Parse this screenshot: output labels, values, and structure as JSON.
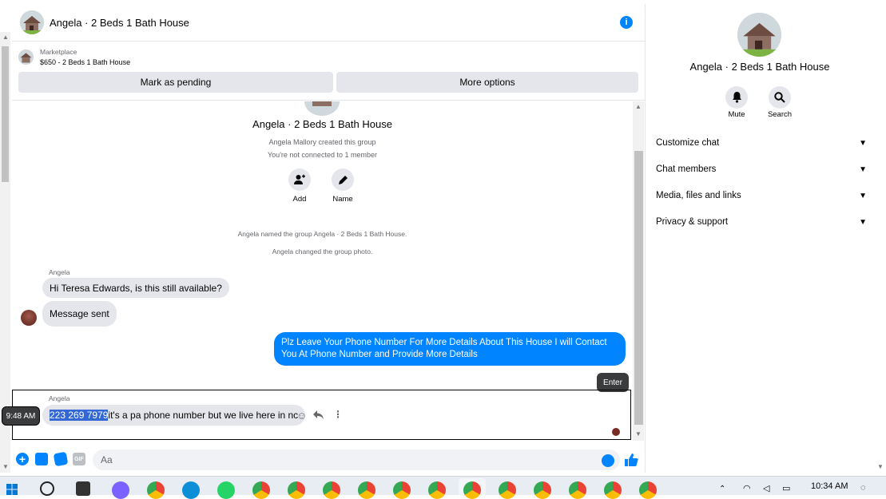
{
  "chat": {
    "title": "Angela · 2 Beds 1 Bath House",
    "marketplace_label": "Marketplace",
    "listing": "$650 - 2 Beds 1 Bath House",
    "mark_pending": "Mark as pending",
    "more_options": "More options",
    "group_title": "Angela · 2 Beds 1 Bath House",
    "created_by": "Angela Mallory created this group",
    "not_connected": "You're not connected to 1 member",
    "add_label": "Add",
    "name_label": "Name",
    "event_named": "Angela named the group Angela · 2 Beds 1 Bath House.",
    "event_photo": "Angela changed the group photo.",
    "sender1": "Angela",
    "msg1": "Hi Teresa Edwards, is this still available?",
    "msg2": "Message sent",
    "msg_out": "Plz Leave Your Phone Number For More Details About This House I will Contact You At Phone Number and Provide More Details",
    "enter_tooltip": "Enter",
    "sender2": "Angela",
    "msg3_highlight": "223 269 7979",
    "msg3_rest": " it's a pa phone number but we live here in nc",
    "time_tooltip": "9:48 AM",
    "input_placeholder": "Aa"
  },
  "panel": {
    "title": "Angela · 2 Beds 1 Bath House",
    "mute": "Mute",
    "search": "Search",
    "rows": [
      "Customize chat",
      "Chat members",
      "Media, files and links",
      "Privacy & support"
    ]
  },
  "taskbar": {
    "time": "10:34 AM"
  },
  "colors": {
    "accent": "#0084ff",
    "bubble_in": "#e4e6eb"
  }
}
